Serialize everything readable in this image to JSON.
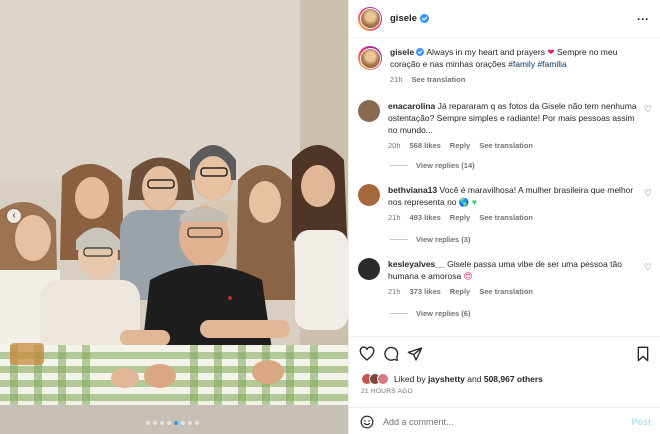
{
  "post": {
    "username": "gisele",
    "caption_user": "gisele",
    "caption_text": "Always in my heart and prayers",
    "caption_text_2": "Sempre no meu coração e nas minhas orações",
    "hashtag_1": "#family",
    "hashtag_2": "#familia",
    "caption_time": "21h",
    "see_translation": "See translation",
    "more_icon": "more-horizontal-icon"
  },
  "comments": [
    {
      "user": "enacarolina",
      "text": "Já repararam q as fotos da Gisele não tem nenhuma ostentação? Sempre simples e radiante! Por mais pessoas assim no mundo...",
      "time": "20h",
      "likes": "568 likes",
      "reply": "Reply",
      "translate": "See translation",
      "view_replies": "View replies (14)",
      "avatar_color": "#8a6a4f"
    },
    {
      "user": "bethviana13",
      "text": "Você é maravilhosa! A mulher brasileira que melhor nos representa no",
      "time": "21h",
      "likes": "493 likes",
      "reply": "Reply",
      "translate": "See translation",
      "view_replies": "View replies (3)",
      "avatar_color": "#a5683e"
    },
    {
      "user": "kesleyalves__",
      "text": "Gisele passa uma vibe de ser uma pessoa tão humana e amorosa",
      "time": "21h",
      "likes": "373 likes",
      "reply": "Reply",
      "translate": "See translation",
      "view_replies": "View replies (6)",
      "avatar_color": "#2b2b2b"
    }
  ],
  "actions": {
    "liked_by_prefix": "Liked by",
    "liked_by_user": "jayshetty",
    "liked_by_and": "and",
    "liked_by_count": "508,967 others",
    "time_ago": "21 HOURS AGO",
    "add_comment_placeholder": "Add a comment...",
    "post_label": "Post"
  },
  "colors": {
    "verified": "#3897f0",
    "link": "#00376b",
    "muted": "#737373",
    "post_disabled": "#b2dffc"
  }
}
